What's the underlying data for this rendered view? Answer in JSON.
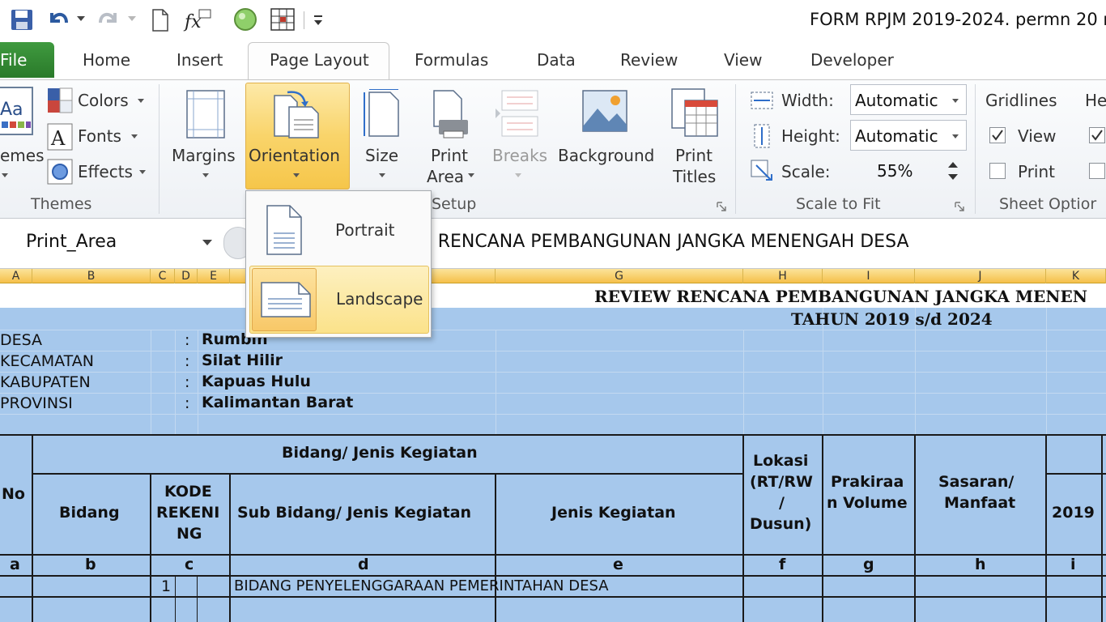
{
  "window": {
    "title": "FORM RPJM 2019-2024. permn 20 r"
  },
  "tabs": [
    {
      "label": "File"
    },
    {
      "label": "Home"
    },
    {
      "label": "Insert"
    },
    {
      "label": "Page Layout"
    },
    {
      "label": "Formulas"
    },
    {
      "label": "Data"
    },
    {
      "label": "Review"
    },
    {
      "label": "View"
    },
    {
      "label": "Developer"
    }
  ],
  "ribbon": {
    "themes": {
      "themes_label": "emes",
      "colors": "Colors",
      "fonts": "Fonts",
      "effects": "Effects",
      "group": "Themes"
    },
    "page_setup": {
      "margins": "Margins",
      "orientation": "Orientation",
      "size": "Size",
      "print_area_1": "Print",
      "print_area_2": "Area",
      "breaks": "Breaks",
      "background": "Background",
      "print_titles_1": "Print",
      "print_titles_2": "Titles",
      "group": "Setup"
    },
    "scale_to_fit": {
      "width_label": "Width:",
      "width_value": "Automatic",
      "height_label": "Height:",
      "height_value": "Automatic",
      "scale_label": "Scale:",
      "scale_value": "55%",
      "group": "Scale to Fit"
    },
    "sheet_options": {
      "gridlines": "Gridlines",
      "headings": "He",
      "view": "View",
      "print": "Print",
      "group": "Sheet Optior"
    }
  },
  "orientation_menu": {
    "portrait": "Portrait",
    "landscape": "Landscape",
    "selected": "Landscape"
  },
  "formula_bar": {
    "name_box": "Print_Area",
    "formula": "W RENCANA PEMBANGUNAN JANGKA MENENGAH DESA"
  },
  "columns": [
    "A",
    "B",
    "C",
    "D",
    "E",
    "G",
    "H",
    "I",
    "J",
    "K"
  ],
  "sheet": {
    "title": "REVIEW RENCANA PEMBANGUNAN JANGKA MENEN",
    "subtitle": "TAHUN 2019 s/d 2024",
    "info": [
      {
        "label": "DESA",
        "colon": ":",
        "value": "Rumbin"
      },
      {
        "label": "KECAMATAN",
        "colon": ":",
        "value": "Silat Hilir"
      },
      {
        "label": "KABUPATEN",
        "colon": ":",
        "value": "Kapuas Hulu"
      },
      {
        "label": "PROVINSI",
        "colon": ":",
        "value": "Kalimantan Barat"
      }
    ],
    "header": {
      "no": "No",
      "bidang_jenis": "Bidang/ Jenis Kegiatan",
      "bidang": "Bidang",
      "kode_1": "KODE",
      "kode_2": "REKENI",
      "kode_3": "NG",
      "sub_bidang": "Sub Bidang/ Jenis Kegiatan",
      "jenis": "Jenis Kegiatan",
      "lokasi_1": "Lokasi",
      "lokasi_2": "(RT/RW",
      "lokasi_3": "/",
      "lokasi_4": "Dusun)",
      "prakiraan_1": "Prakiraa",
      "prakiraan_2": "n Volume",
      "sasaran_1": "Sasaran/",
      "sasaran_2": "Manfaat",
      "year": "2019"
    },
    "letters": [
      "a",
      "b",
      "c",
      "d",
      "e",
      "f",
      "g",
      "h",
      "i"
    ],
    "row1": {
      "code": "1",
      "text": "BIDANG PENYELENGGARAAN PEMERINTAHAN DESA"
    }
  }
}
